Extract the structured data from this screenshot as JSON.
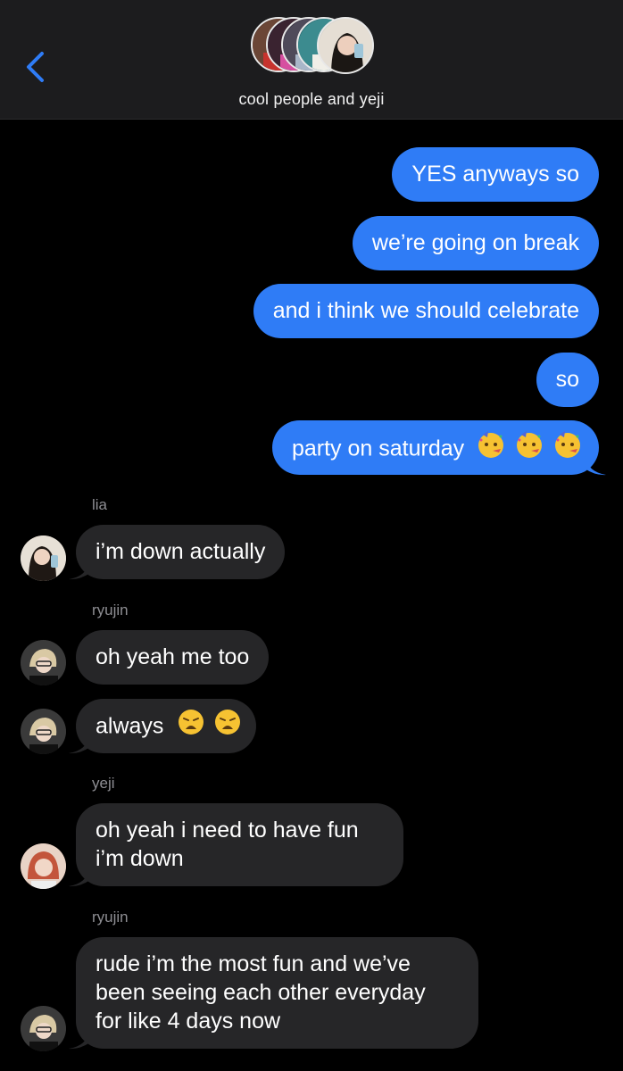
{
  "header": {
    "group_name": "cool people and yeji",
    "back_icon": "chevron-left-icon"
  },
  "messages_out": [
    {
      "text": "YES anyways so"
    },
    {
      "text": "we’re going on break"
    },
    {
      "text": "and i think we should celebrate"
    },
    {
      "text": "so"
    },
    {
      "text": "party on saturday",
      "emojis": [
        "partying-face",
        "partying-face",
        "partying-face"
      ]
    }
  ],
  "messages_in": [
    {
      "sender": "lia",
      "text": "i’m down actually"
    },
    {
      "sender": "ryujin",
      "text": "oh yeah me too"
    },
    {
      "text": "always",
      "emojis": [
        "weary-face",
        "weary-face"
      ]
    },
    {
      "sender": "yeji",
      "lines": [
        "oh yeah i need to have fun",
        "i’m down"
      ]
    },
    {
      "sender": "ryujin",
      "lines": [
        "rude i’m the most fun and we’ve",
        "been seeing each other everyday",
        "for like 4 days now"
      ]
    }
  ],
  "colors": {
    "outgoing_bubble": "#2f7cf6",
    "incoming_bubble": "#262628",
    "header_bg": "#1c1c1e",
    "accent": "#2f7cf6"
  }
}
